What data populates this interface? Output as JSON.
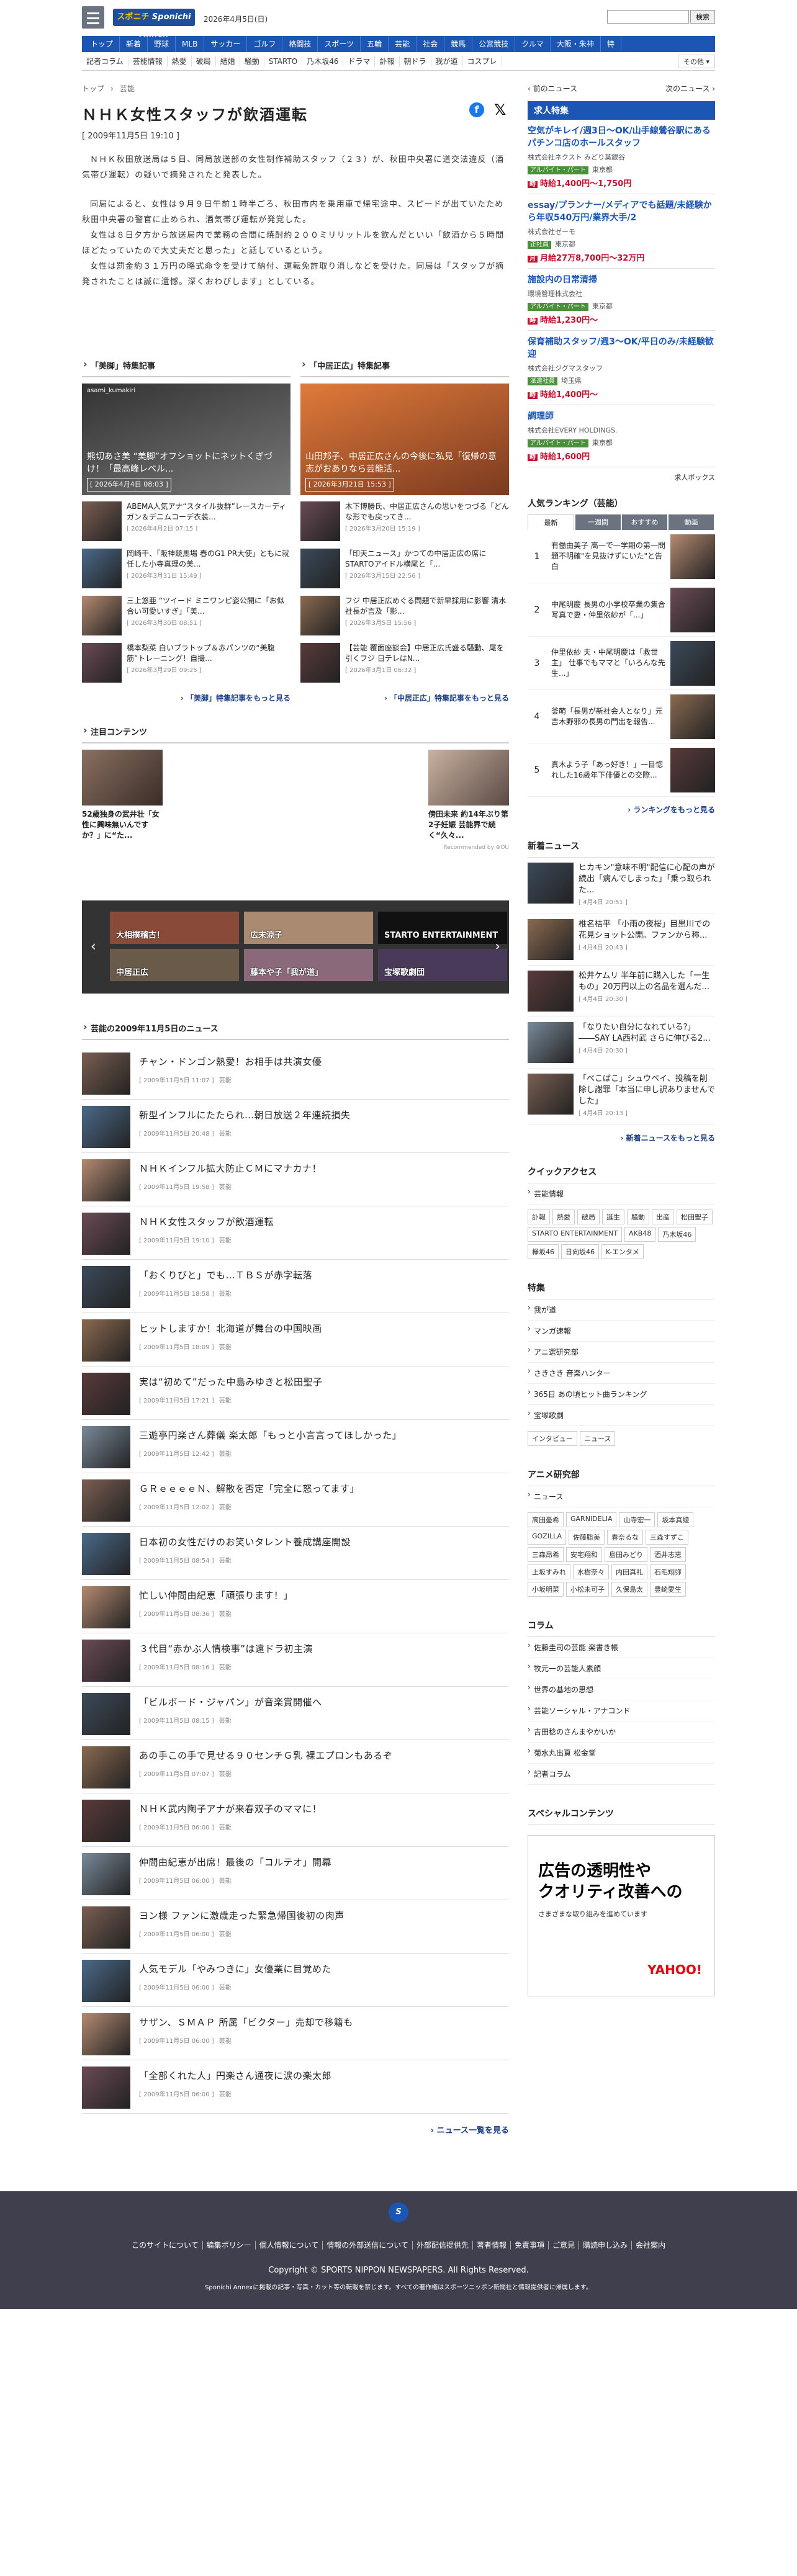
{
  "header": {
    "logo_top": "スポニチ",
    "logo_main": "Sponichi Annex",
    "date": "2026年4月5日(日)",
    "search_placeholder": "",
    "search_btn": "検索"
  },
  "gnav": [
    "トップ",
    "新着",
    "野球",
    "MLB",
    "サッカー",
    "ゴルフ",
    "格闘技",
    "スポーツ",
    "五輪",
    "芸能",
    "社会",
    "競馬",
    "公営競技",
    "クルマ",
    "大阪・朱神",
    "特"
  ],
  "subnav": [
    "記者コラム",
    "芸能情報",
    "熱愛",
    "破局",
    "結婚",
    "騒動",
    "STARTO",
    "乃木坂46",
    "ドラマ",
    "訃報",
    "朝ドラ",
    "我が道",
    "コスプレ"
  ],
  "subnav_more": "その他 ▾",
  "breadcrumb": [
    "トップ",
    "›",
    "芸能"
  ],
  "article": {
    "title": "ＮＨＫ女性スタッフが飲酒運転",
    "date": "[ 2009年11月5日 19:10 ]",
    "paras": [
      "ＮＨＫ秋田放送局は５日、同局放送部の女性制作補助スタッフ（２３）が、秋田中央署に道交法違反（酒気帯び運転）の疑いで摘発されたと発表した。",
      "同局によると、女性は９月９日午前１時半ごろ、秋田市内を乗用車で帰宅途中、スピードが出ていたため秋田中央署の警官に止められ、酒気帯び運転が発覚した。",
      "女性は８日夕方から放送局内で業務の合間に焼酎約２００ミリリットルを飲んだといい「飲酒から５時間ほどたっていたので大丈夫だと思った」と話しているという。",
      "女性は罰金約３１万円の略式命令を受けて納付、運転免許取り消しなどを受けた。同局は「スタッフが摘発されたことは誠に遺憾。深くおわびします」としている。"
    ]
  },
  "share": {
    "fb": "f",
    "x": "𝕏"
  },
  "feat": {
    "left": {
      "hd": "「美脚」特集記事",
      "big": "熊切あさ美 “美脚”オフショットにネットくぎづけ！「最高峰レベル...",
      "big_date": "[ 2026年4月4日 08:03 ]",
      "big_user": "asami_kumakiri",
      "items": [
        {
          "t": "ABEMA人気アナ“スタイル抜群”レースカーディガン＆デニムコーデ衣装...",
          "d": "[ 2026年4月2日 07:15 ]"
        },
        {
          "t": "岡崎千、「阪神競馬場 春のG1 PR大使」ともに就任した小寺真理の美...",
          "d": "[ 2026年3月31日 15:49 ]"
        },
        {
          "t": "三上悠亜 “ツイード ミニワンピ姿公開に「お似合い可愛いすぎ」「美...",
          "d": "[ 2026年3月30日 08:51 ]"
        },
        {
          "t": "橋本梨菜 白いプラトップ＆赤パンツの“美腹筋”トレーニング！自撮...",
          "d": "[ 2026年3月29日 09:25 ]"
        }
      ],
      "more": "「美脚」特集記事をもっと見る"
    },
    "right": {
      "hd": "「中居正広」特集記事",
      "big": "山田邦子、中居正広さんの今後に私見「復帰の意志がおありなら芸能活...",
      "big_date": "[ 2026年3月21日 15:53 ]",
      "items": [
        {
          "t": "木下博勝氏、中居正広さんの思いをつづる「どんな形でも戻ってき...",
          "d": "[ 2026年3月20日 15:19 ]"
        },
        {
          "t": "「印天ニュース」かつての中居正広の席にSTARTOアイドル横尾と「...",
          "d": "[ 2026年3月15日 22:56 ]"
        },
        {
          "t": "フジ 中居正広めぐる問題で新早採用に影響 清水社長が言及「影...",
          "d": "[ 2026年3月5日 15:56 ]"
        },
        {
          "t": "【芸能 覆面座談会】中居正広氏盛る騒動、尾を引くフジ 日テレはN...",
          "d": "[ 2026年3月1日 06:32 ]"
        }
      ],
      "more": "「中居正広」特集記事をもっと見る"
    }
  },
  "attn": {
    "hd": "注目コンテンツ",
    "items": [
      {
        "t": "52歳独身の武井壮「女性に興味無いんですか？」に“た..."
      },
      {
        "t": "傍田未来 約14年ぶり第2子妊娠 芸能界で続く“久々..."
      }
    ],
    "powered": "Recommended by ⊕OU"
  },
  "carousel": [
    "大相撲稽古！",
    "広末涼子",
    "STARTO ENTERTAINMENT",
    "中居正広",
    "藤本や子「我が道」",
    "宝塚歌劇団"
  ],
  "newslist": {
    "hd": "芸能の2009年11月5日のニュース",
    "items": [
      {
        "t": "チャン・ドンゴン熱愛！お相手は共演女優",
        "d": "[ 2009年11月5日 11:07 ]"
      },
      {
        "t": "新型インフルにたたられ…朝日放送２年連続損失",
        "d": "[ 2009年11月5日 20:48 ]"
      },
      {
        "t": "ＮＨＫインフル拡大防止ＣＭにマナカナ！",
        "d": "[ 2009年11月5日 19:58 ]"
      },
      {
        "t": "ＮＨＫ女性スタッフが飲酒運転",
        "d": "[ 2009年11月5日 19:10 ]"
      },
      {
        "t": "「おくりびと」でも…ＴＢＳが赤字転落",
        "d": "[ 2009年11月5日 18:58 ]"
      },
      {
        "t": "ヒットしますか！北海道が舞台の中国映画",
        "d": "[ 2009年11月5日 18:09 ]"
      },
      {
        "t": "実は“初めて”だった中島みゆきと松田聖子",
        "d": "[ 2009年11月5日 17:21 ]"
      },
      {
        "t": "三遊亭円楽さん葬儀 楽太郎「もっと小言言ってほしかった」",
        "d": "[ 2009年11月5日 12:42 ]"
      },
      {
        "t": "ＧＲｅｅｅｅＮ、解散を否定「完全に怒ってます」",
        "d": "[ 2009年11月5日 12:02 ]"
      },
      {
        "t": "日本初の女性だけのお笑いタレント養成講座開設",
        "d": "[ 2009年11月5日 08:54 ]"
      },
      {
        "t": "忙しい仲間由紀恵「頑張ります！」",
        "d": "[ 2009年11月5日 08:36 ]"
      },
      {
        "t": "３代目“赤かぶ人情検事”は遠ドラ初主演",
        "d": "[ 2009年11月5日 08:16 ]"
      },
      {
        "t": "「ビルボード・ジャパン」が音楽賞開催へ",
        "d": "[ 2009年11月5日 08:15 ]"
      },
      {
        "t": "あの手この手で見せる９０センチＧ乳 裸エプロンもあるぞ",
        "d": "[ 2009年11月5日 07:07 ]"
      },
      {
        "t": "ＮＨＫ武内陶子アナが来春双子のママに！",
        "d": "[ 2009年11月5日 06:00 ]"
      },
      {
        "t": "仲間由紀恵が出席！最後の「コルテオ」開幕",
        "d": "[ 2009年11月5日 06:00 ]"
      },
      {
        "t": "ヨン様 ファンに激歳走った緊急帰国後初の肉声",
        "d": "[ 2009年11月5日 06:00 ]"
      },
      {
        "t": "人気モデル「やみつきに」女優業に目覚めた",
        "d": "[ 2009年11月5日 06:00 ]"
      },
      {
        "t": "サザン、ＳＭＡＰ 所属「ビクター」売却で移籍も",
        "d": "[ 2009年11月5日 06:00 ]"
      },
      {
        "t": "「全部くれた人」円楽さん通夜に涙の楽太郎",
        "d": "[ 2009年11月5日 06:00 ]"
      }
    ],
    "cat": "芸能",
    "more": "ニュース一覧を見る"
  },
  "side": {
    "prev": "‹ 前のニュース",
    "next": "次のニュース ›",
    "jobhd": "求人特集",
    "jobs": [
      {
        "t": "空気がキレイ/週3日〜OK/山手線鶯谷駅にあるパチンコ店のホールスタッフ",
        "co": "株式会社ネクスト みどり葉銀谷",
        "tg": "アルバイト・パート",
        "loc": "東京都",
        "pay": "時給1,400円〜1,750円",
        "pl": "時"
      },
      {
        "t": "essay/プランナー/メディアでも話題/未経験から年収540万円/業界大手/2",
        "co": "株式会社ゼーモ",
        "tg": "正社員",
        "loc": "東京都",
        "pay": "月給27万8,700円〜32万円",
        "pl": "月"
      },
      {
        "t": "施設内の日常清掃",
        "co": "環境管理株式会社",
        "tg": "アルバイト・パート",
        "loc": "東京都",
        "pay": "時給1,230円〜",
        "pl": "時"
      },
      {
        "t": "保育補助スタッフ/週3〜OK/平日のみ/未経験歓迎",
        "co": "株式会社ジグマスタッフ",
        "tg": "派遣社員",
        "loc": "埼玉県",
        "pay": "時給1,400円〜",
        "pl": "時"
      },
      {
        "t": "調理師",
        "co": "株式会社EVERY HOLDINGS.",
        "tg": "アルバイト・パート",
        "loc": "東京都",
        "pay": "時給1,600円",
        "pl": "時"
      }
    ],
    "jobfoot": "求人ボックス",
    "rankhd": "人気ランキング（芸能）",
    "tabs": [
      "最新",
      "一週間",
      "おすすめ",
      "動画"
    ],
    "ranks": [
      {
        "n": "1",
        "t": "有働由美子 高一で一学期の第一問題不明確\"を見抜けずにいた\"と告白"
      },
      {
        "n": "2",
        "t": "中尾明慶 長男の小学校卒業の集合写真で妻・仲里依紗が「...」"
      },
      {
        "n": "3",
        "t": "仲里依紗 夫・中尾明慶は「救世主」 仕事でもママと「いろんな先生...」"
      },
      {
        "n": "4",
        "t": "釜萌「長男が新社会人となり」元吉木野邪の長男の門出を報告..."
      },
      {
        "n": "5",
        "t": "真木よう子「あっ好き！」一目惚れした16歳年下俳優との交際..."
      }
    ],
    "rankmore": "ランキングをもっと見る",
    "nnhd": "新着ニュース",
    "nn": [
      {
        "t": "ヒカキン\"意味不明\"配信に心配の声が続出「病んでしまった」「乗っ取られた...",
        "d": "[ 4月4日 20:51 ]"
      },
      {
        "t": "椎名桔平 「小雨の夜桜」目黒川での花見ショット公開。ファンから称...",
        "d": "[ 4月4日 20:43 ]"
      },
      {
        "t": "松井ケムリ 半年前に購入した「一生もの」20万円以上の名品を選んだ...",
        "d": "[ 4月4日 20:30 ]"
      },
      {
        "t": "「なりたい自分になれている?」――SAY LA西村武 さらに伸びる2...",
        "d": "[ 4月4日 20:30 ]"
      },
      {
        "t": "「べこばこ」シュウペイ、投稿を削除し謝罪「本当に申し訳ありませんでした」",
        "d": "[ 4月4日 20:13 ]"
      }
    ],
    "nnmore": "新着ニュースをもっと見る",
    "qahd": "クイックアクセス",
    "qa_item": "芸能情報",
    "qa_tags": [
      "訃報",
      "熱愛",
      "破局",
      "誕生",
      "騒動",
      "出産",
      "松田聖子",
      "STARTO ENTERTAINMENT",
      "AKB48",
      "乃木坂46",
      "欅坂46",
      "日向坂46",
      "K-エンタメ"
    ],
    "tokushuhd": "特集",
    "tokushu": [
      "我が道",
      "マンガ速報",
      "アニ選研究部",
      "さきさき 音楽ハンター",
      "365日 あの頃ヒット曲ランキング",
      "宝塚歌劇"
    ],
    "tokushu_tags": [
      "インタビュー",
      "ニュース"
    ],
    "animehd": "アニメ研究部",
    "anime_item": "ニュース",
    "anime_tags": [
      "高田憂希",
      "GARNIDELIA",
      "山寺宏一",
      "坂本真綾",
      "GOZILLA",
      "佐藤聡美",
      "春奈るな",
      "三森すずこ",
      "三森昂希",
      "安宅翔和",
      "島田みどり",
      "酒井志恵",
      "上坂すみれ",
      "水樹奈々",
      "内田真礼",
      "石毛翔弥",
      "小坂明菜",
      "小松未可子",
      "久保島太",
      "豊崎愛生"
    ],
    "columnhd": "コラム",
    "columns": [
      "佐藤圭司の芸能 楽書き帳",
      "牧元一の芸能人素顔",
      "世界の基地の思想",
      "芸能ソーシャル・アナコンド",
      "吉田稔のさんまやかいか",
      "菊水丸出頁 松金堂",
      "記者コラム"
    ],
    "sphd": "スペシャルコンテンツ",
    "ad": {
      "t1": "広告の透明性や",
      "t2": "クオリティ改善への",
      "s": "さまざまな取り組みを進めています",
      "yj": "YAHOO!"
    }
  },
  "footer": {
    "logo": "S",
    "links": [
      "このサイトについて",
      "編集ポリシー",
      "個人情報について",
      "情報の外部送信について",
      "外部配信提供先",
      "著者情報",
      "免責事項",
      "ご意見",
      "購読申し込み",
      "会社案内"
    ],
    "copy": "Copyright © SPORTS NIPPON NEWSPAPERS. All Rights Reserved.",
    "note": "Sponichi Annexに掲載の記事・写真・カット等の転載を禁じます。すべての著作権はスポーツニッポン新聞社と情報提供者に帰属します。"
  }
}
